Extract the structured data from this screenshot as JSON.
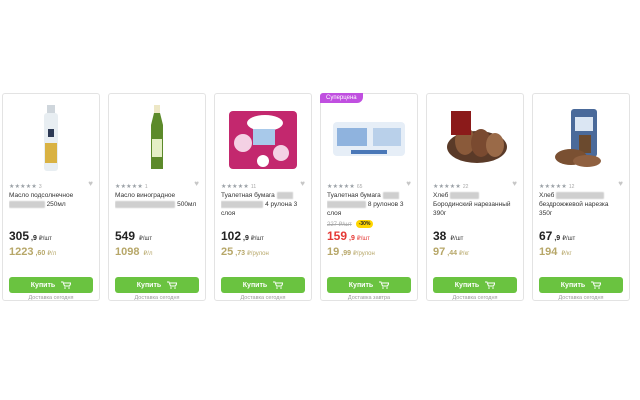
{
  "accent_green": "#6ac340",
  "promo_color": "#c04fe0",
  "products": [
    {
      "image": "oil-bottle-image",
      "rating": "★★★★★",
      "rating_count": "3",
      "title_parts": [
        "Масло подсолнечное",
        "",
        "250мл"
      ],
      "price_int": "305",
      "price_dec": ",9",
      "price_unit": "₽/шт",
      "alt_int": "1223",
      "alt_dec": ",60",
      "alt_unit": "₽/л",
      "buy_label": "Купить",
      "delivery": "Доставка сегодня"
    },
    {
      "image": "grape-oil-bottle-image",
      "rating": "★★★★★",
      "rating_count": "1",
      "title_parts": [
        "Масло виноградное",
        "",
        "500мл"
      ],
      "price_int": "549",
      "price_dec": "",
      "price_unit": "₽/шт",
      "alt_int": "1098",
      "alt_dec": "",
      "alt_unit": "₽/л",
      "buy_label": "Купить",
      "delivery": "Доставка сегодня"
    },
    {
      "image": "toilet-paper-image",
      "rating": "★★★★★",
      "rating_count": "11",
      "title_parts": [
        "Туалетная бумага",
        "",
        "4 рулона 3 слоя"
      ],
      "price_int": "102",
      "price_dec": ",9",
      "price_unit": "₽/шт",
      "alt_int": "25",
      "alt_dec": ",73",
      "alt_unit": "₽/рулон",
      "buy_label": "Купить",
      "delivery": "Доставка сегодня"
    },
    {
      "promo": "Суперцена",
      "image": "toilet-paper-pack-image",
      "rating": "★★★★★",
      "rating_count": "65",
      "title_parts": [
        "Туалетная бумага",
        "",
        "8 рулонов 3 слоя"
      ],
      "old_price": "227 ₽/шт",
      "discount": "-30%",
      "price_int": "159",
      "price_dec": ",9",
      "price_unit": "₽/шт",
      "alt_int": "19",
      "alt_dec": ",99",
      "alt_unit": "₽/рулон",
      "buy_label": "Купить",
      "delivery": "Доставка завтра"
    },
    {
      "image": "borodinsky-bread-image",
      "rating": "★★★★★",
      "rating_count": "22",
      "title_parts": [
        "Хлеб",
        "",
        "Бородинский нарезанный 390г"
      ],
      "price_int": "38",
      "price_dec": "",
      "price_unit": "₽/шт",
      "alt_int": "97",
      "alt_dec": ",44",
      "alt_unit": "₽/кг",
      "buy_label": "Купить",
      "delivery": "Доставка сегодня"
    },
    {
      "image": "yeastfree-bread-image",
      "rating": "★★★★★",
      "rating_count": "12",
      "title_parts": [
        "Хлеб",
        "",
        "бездрожжевой нарезка 350г"
      ],
      "price_int": "67",
      "price_dec": ",9",
      "price_unit": "₽/шт",
      "alt_int": "194",
      "alt_dec": "",
      "alt_unit": "₽/кг",
      "buy_label": "Купить",
      "delivery": "Доставка сегодня"
    }
  ]
}
